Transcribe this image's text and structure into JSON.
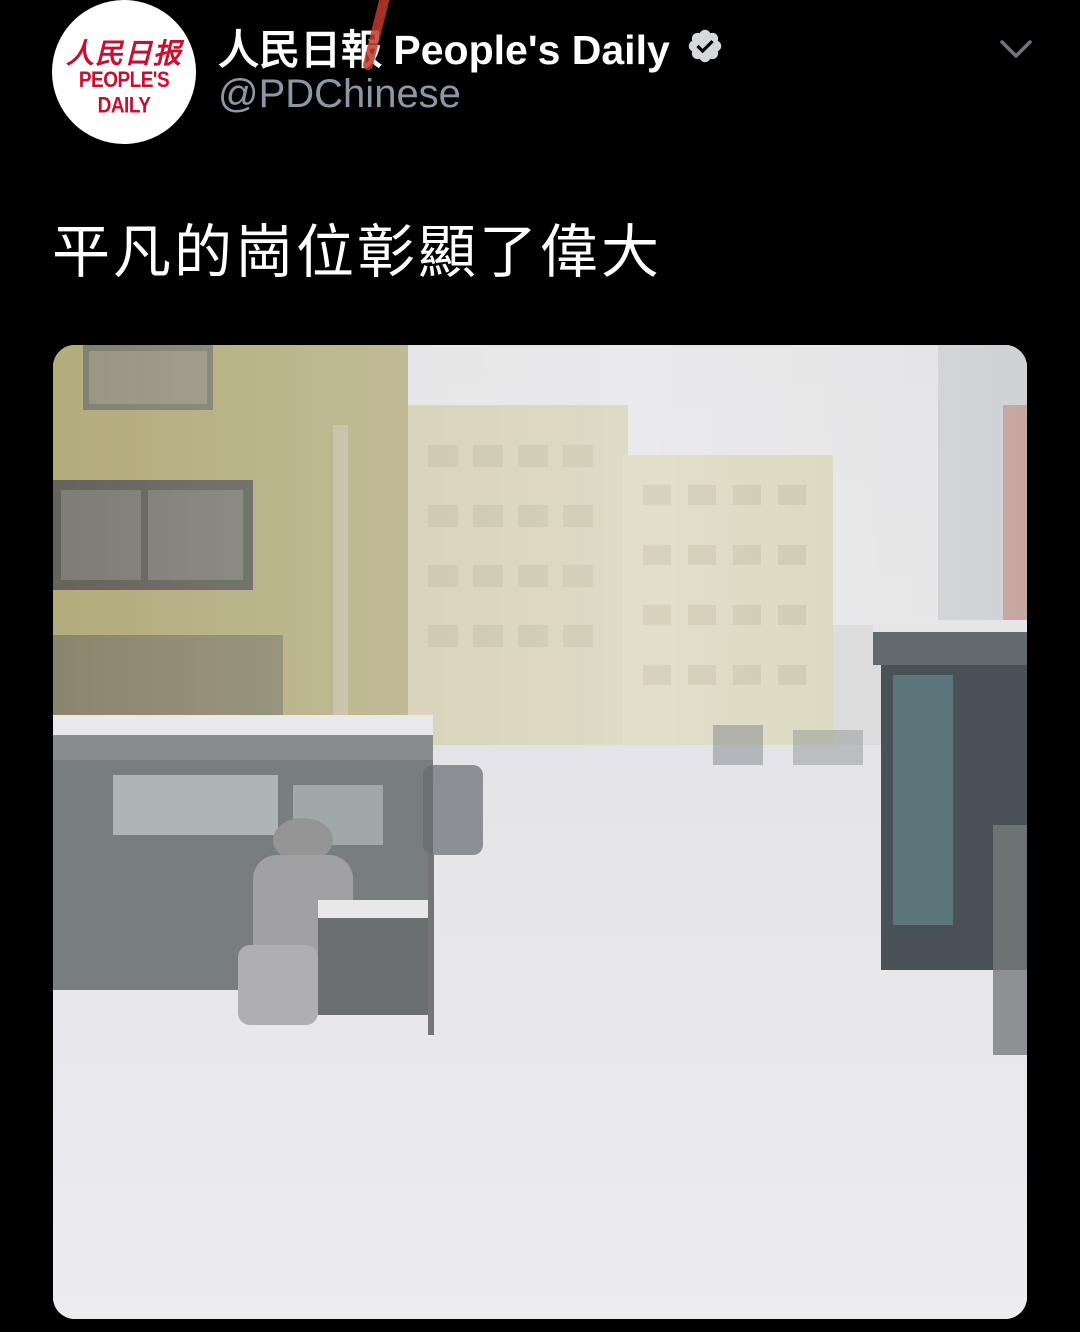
{
  "account": {
    "display_name": "人民日報 People's Daily",
    "handle": "@PDChinese",
    "avatar_logo_cn": "人民日报",
    "avatar_logo_en": "PEOPLE'S DAILY",
    "verified": true
  },
  "tweet": {
    "text": "平凡的崗位彰顯了偉大"
  },
  "icons": {
    "verified": "verified-badge-icon",
    "menu": "chevron-down-icon"
  },
  "colors": {
    "background": "#000000",
    "text_primary": "#ffffff",
    "text_secondary": "#8b98a5",
    "logo_red": "#c8102e"
  }
}
